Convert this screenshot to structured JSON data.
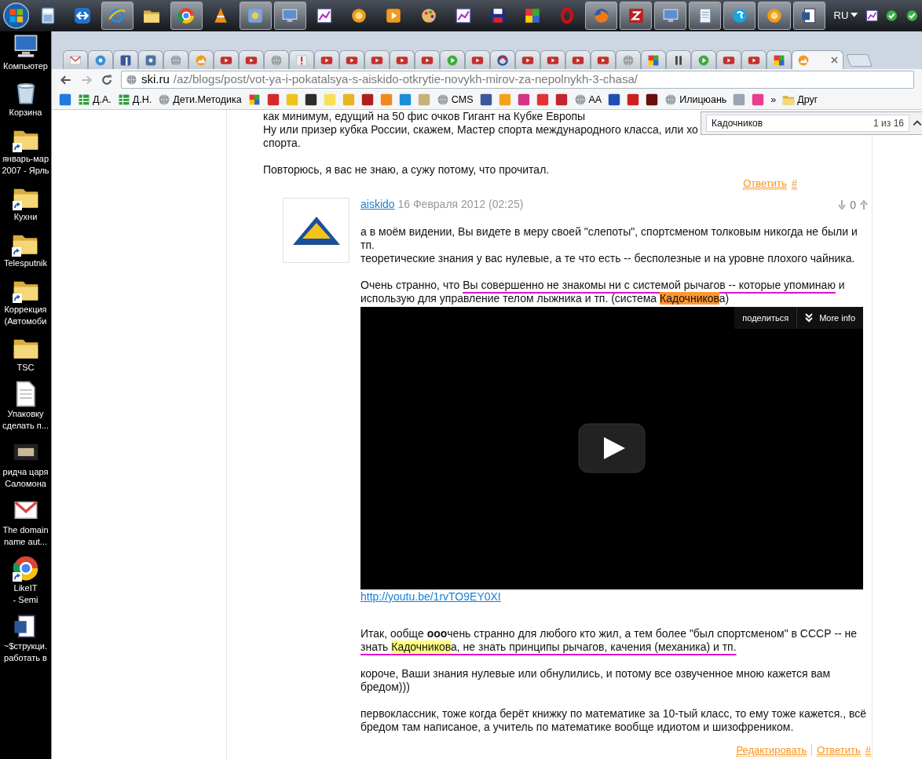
{
  "taskbar": {
    "items": [
      {
        "kind": "calculator",
        "active": false
      },
      {
        "kind": "arrows",
        "active": false
      },
      {
        "kind": "ie",
        "active": true
      },
      {
        "kind": "folder",
        "active": false
      },
      {
        "kind": "chrome",
        "active": true
      },
      {
        "kind": "cone",
        "active": false
      },
      {
        "kind": "app",
        "active": true
      },
      {
        "kind": "monitor",
        "active": true
      },
      {
        "kind": "chart",
        "active": false
      },
      {
        "kind": "sun",
        "active": false
      },
      {
        "kind": "play",
        "active": false
      },
      {
        "kind": "palette",
        "active": false
      },
      {
        "kind": "chart",
        "active": false
      },
      {
        "kind": "floppy",
        "active": false
      },
      {
        "kind": "photo",
        "active": false
      },
      {
        "kind": "ring",
        "active": false
      },
      {
        "kind": "fox",
        "active": true
      },
      {
        "kind": "redapp",
        "active": true
      },
      {
        "kind": "monitor",
        "active": true
      },
      {
        "kind": "notepad",
        "active": true
      },
      {
        "kind": "chat",
        "active": true
      },
      {
        "kind": "sun",
        "active": true
      },
      {
        "kind": "word",
        "active": true
      }
    ],
    "language": "RU",
    "tray": [
      {
        "kind": "chart"
      },
      {
        "kind": "check"
      },
      {
        "kind": "check"
      }
    ]
  },
  "desktop": {
    "items": [
      {
        "kind": "computer",
        "shortcut": false,
        "label": [
          "Компьютер"
        ]
      },
      {
        "kind": "trash",
        "shortcut": false,
        "label": [
          "Корзина"
        ]
      },
      {
        "kind": "folder",
        "shortcut": true,
        "label": [
          "январь-мар",
          "2007 - Ярль"
        ]
      },
      {
        "kind": "folder",
        "shortcut": true,
        "label": [
          "Кухни"
        ]
      },
      {
        "kind": "folder",
        "shortcut": true,
        "label": [
          "Telesputnik"
        ]
      },
      {
        "kind": "folder",
        "shortcut": true,
        "label": [
          "Коррекция",
          "(Автомоби"
        ]
      },
      {
        "kind": "folder",
        "shortcut": false,
        "label": [
          "TSC"
        ]
      },
      {
        "kind": "page",
        "shortcut": false,
        "label": [
          "Упаковку",
          "сделать п..."
        ]
      },
      {
        "kind": "thumb",
        "shortcut": false,
        "label": [
          "ридча царя",
          "Саломона"
        ]
      },
      {
        "kind": "mail",
        "shortcut": false,
        "label": [
          "The domain",
          "name aut..."
        ]
      },
      {
        "kind": "chrome",
        "shortcut": true,
        "label": [
          "LikeIT",
          "- Semi"
        ]
      },
      {
        "kind": "word",
        "shortcut": false,
        "label": [
          "~$струкци.",
          "работать в"
        ]
      }
    ]
  },
  "browser": {
    "tabs": [
      {
        "kind": "mail",
        "selected": false
      },
      {
        "kind": "bluecircle",
        "selected": false
      },
      {
        "kind": "fb",
        "selected": false
      },
      {
        "kind": "vk",
        "selected": false
      },
      {
        "kind": "globe",
        "selected": false
      },
      {
        "kind": "mountain",
        "selected": false
      },
      {
        "kind": "video",
        "selected": false
      },
      {
        "kind": "video",
        "selected": false
      },
      {
        "kind": "globe",
        "selected": false
      },
      {
        "kind": "alert",
        "selected": false
      },
      {
        "kind": "video",
        "selected": false
      },
      {
        "kind": "video",
        "selected": false
      },
      {
        "kind": "video",
        "selected": false
      },
      {
        "kind": "video",
        "selected": false
      },
      {
        "kind": "video",
        "selected": false
      },
      {
        "kind": "greenplay",
        "selected": false
      },
      {
        "kind": "video",
        "selected": false
      },
      {
        "kind": "swirl",
        "selected": false
      },
      {
        "kind": "video",
        "selected": false
      },
      {
        "kind": "video",
        "selected": false
      },
      {
        "kind": "video",
        "selected": false
      },
      {
        "kind": "video",
        "selected": false
      },
      {
        "kind": "globe",
        "selected": false
      },
      {
        "kind": "photo",
        "selected": false
      },
      {
        "kind": "pause",
        "selected": false
      },
      {
        "kind": "greenplay",
        "selected": false
      },
      {
        "kind": "video",
        "selected": false
      },
      {
        "kind": "video",
        "selected": false
      },
      {
        "kind": "photo",
        "selected": false
      },
      {
        "kind": "mountain",
        "selected": true
      }
    ],
    "url": {
      "host": "ski.ru",
      "path": "/az/blogs/post/vot-ya-i-pokatalsya-s-aiskido-otkrytie-novykh-mirov-za-nepolnykh-3-chasa/"
    },
    "bookmarks": [
      {
        "kind": "tile",
        "color": "#1f7be0"
      },
      {
        "kind": "grid",
        "label": "Д.А."
      },
      {
        "kind": "grid",
        "label": "Д.Н."
      },
      {
        "kind": "globe",
        "label": "Дети.Методика"
      },
      {
        "kind": "photo"
      },
      {
        "kind": "tile",
        "color": "#d42a2a"
      },
      {
        "kind": "tile",
        "color": "#f0c419"
      },
      {
        "kind": "tile",
        "color": "#2b2b2b"
      },
      {
        "kind": "tile",
        "color": "#f6e05a"
      },
      {
        "kind": "tile",
        "color": "#e8b422"
      },
      {
        "kind": "tile",
        "color": "#b01e1e"
      },
      {
        "kind": "tile",
        "color": "#f08a1c"
      },
      {
        "kind": "tile",
        "color": "#1a8fd6"
      },
      {
        "kind": "tile",
        "color": "#c8b27a"
      },
      {
        "kind": "globe",
        "label": "CMS"
      },
      {
        "kind": "tile",
        "color": "#3b5998"
      },
      {
        "kind": "tile",
        "color": "#f4a21b"
      },
      {
        "kind": "tile",
        "color": "#d63384"
      },
      {
        "kind": "tile",
        "color": "#e43137"
      },
      {
        "kind": "tile",
        "color": "#c0262d"
      },
      {
        "kind": "globe",
        "label": "AA"
      },
      {
        "kind": "tile",
        "color": "#1f4fb5"
      },
      {
        "kind": "tile",
        "color": "#cc1f1f"
      },
      {
        "kind": "tile",
        "color": "#6b0b0b"
      },
      {
        "kind": "globe",
        "label": "Илицюань"
      },
      {
        "kind": "tile",
        "color": "#9aa5b1"
      },
      {
        "kind": "tile",
        "color": "#e83e8c"
      },
      {
        "kind": "more",
        "label": "»"
      },
      {
        "kind": "folder",
        "label": "Друг"
      }
    ],
    "find_bar": {
      "query": "Кадочников",
      "count": "1 из 16"
    }
  },
  "parent_comment": {
    "paragraphs": [
      [
        "как минимум, едущий на 50 фис очков Гигант на Кубке Европы",
        "Ну или призер кубка России, скажем, Мастер спорта международного класса, или хо",
        "спорта."
      ],
      [
        "Повторюсь, я вас не знаю, а сужу потому, что прочитал."
      ]
    ],
    "actions": [
      "Ответить",
      "#"
    ]
  },
  "reply": {
    "author": "aiskido",
    "date": "16 Февраля 2012 (02:25)",
    "score": "0",
    "body": [
      {
        "kind": "text",
        "lines": [
          [
            {
              "text": "а в моём видении, Вы видете в меру своей \"слепоты\", спортсменом толковым никогда не были и тп."
            }
          ],
          [
            {
              "text": "теоретические знания у вас нулевые, а те что есть -- бесполезные и на уровне плохого чайника."
            }
          ]
        ]
      },
      {
        "kind": "text",
        "lines": [
          [
            {
              "text": "Очень странно, что "
            },
            {
              "text": "Вы совершенно не знакомы ни с системой рычагов -- которые упоминаю",
              "annotated": true
            },
            {
              "text": " и использую для управление телом лыжника и тп.  (система "
            },
            {
              "text": "Кадочников",
              "highlighted": true,
              "current": true
            },
            {
              "text": "а)"
            }
          ]
        ]
      },
      {
        "kind": "video",
        "share": "поделиться",
        "more": "More info"
      },
      {
        "kind": "link",
        "text": "http://youtu.be/1rvTO9EY0XI"
      },
      {
        "kind": "text",
        "lines": [
          [
            {
              "text": "Итак, ообще "
            },
            {
              "text": "ооо",
              "bold": true
            },
            {
              "text": "чень странно для любого кто жил, а тем более \"был спортсменом\" в СССР -- не "
            },
            {
              "text": "знать ",
              "annotated": true
            },
            {
              "text": "Кадочников",
              "highlighted": true,
              "current": false,
              "annotated": true
            },
            {
              "text": "а, не знать принципы рычагов, качения (механика) и тп.",
              "annotated": true
            }
          ]
        ]
      },
      {
        "kind": "text",
        "lines": [
          [
            {
              "text": "короче, Ваши знания нулевые или обнулились, и потому все озвученное мною кажется вам бредом)))"
            }
          ]
        ]
      },
      {
        "kind": "text",
        "lines": [
          [
            {
              "text": "первоклассник, тоже когда берёт книжку по математике за 10-тый класс, то ему тоже кажется., всё бредом там написаное, а учитель по математике вообще идиотом и шизофреником."
            }
          ]
        ]
      }
    ],
    "actions": [
      "Редактировать",
      "Ответить",
      "#"
    ]
  }
}
